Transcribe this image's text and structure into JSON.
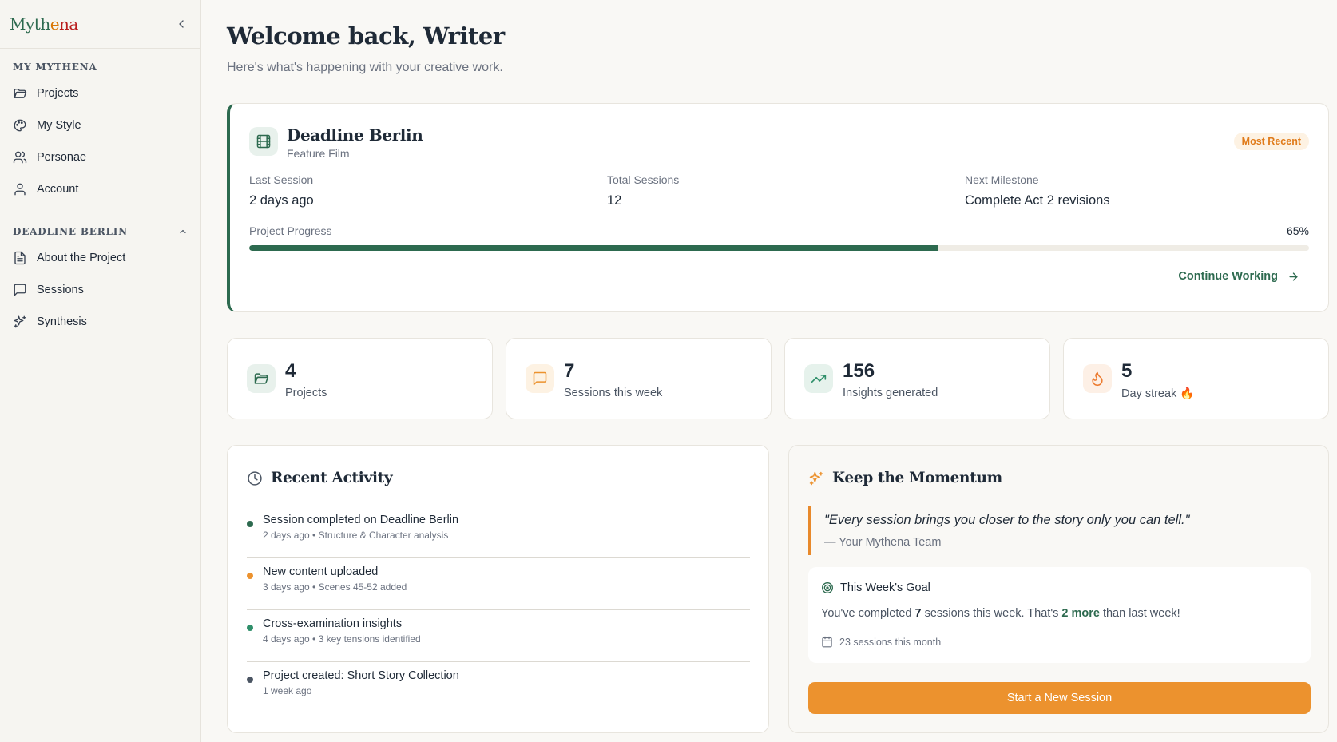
{
  "app": {
    "logo_parts": [
      "Myth",
      "e",
      "na"
    ],
    "colors": {
      "brand_green": "#2d6a4f",
      "accent_orange": "#ec922e",
      "badge_orange": "#e07b1a"
    }
  },
  "sidebar": {
    "sections": [
      {
        "title": "My Mythena",
        "items": [
          {
            "label": "Projects",
            "icon": "folder-icon"
          },
          {
            "label": "My Style",
            "icon": "palette-icon"
          },
          {
            "label": "Personae",
            "icon": "users-icon"
          },
          {
            "label": "Account",
            "icon": "user-icon"
          }
        ]
      },
      {
        "title": "Deadline Berlin",
        "items": [
          {
            "label": "About the Project",
            "icon": "document-icon"
          },
          {
            "label": "Sessions",
            "icon": "chat-bubble-icon"
          },
          {
            "label": "Synthesis",
            "icon": "sparkles-icon"
          }
        ]
      }
    ]
  },
  "header": {
    "welcome": "Welcome back, Writer",
    "subtitle": "Here's what's happening with your creative work."
  },
  "project": {
    "title": "Deadline Berlin",
    "type": "Feature Film",
    "badge": "Most Recent",
    "stats": [
      {
        "label": "Last Session",
        "value": "2 days ago"
      },
      {
        "label": "Total Sessions",
        "value": "12"
      },
      {
        "label": "Next Milestone",
        "value": "Complete Act 2 revisions"
      }
    ],
    "progress_label": "Project Progress",
    "progress_text": "65%",
    "progress_value": 0.65,
    "continue_label": "Continue Working"
  },
  "metrics": [
    {
      "number": "4",
      "label": "Projects",
      "icon": "folder-icon"
    },
    {
      "number": "7",
      "label": "Sessions this week",
      "icon": "chat-bubble-icon"
    },
    {
      "number": "156",
      "label": "Insights generated",
      "icon": "trending-up-icon"
    },
    {
      "number": "5",
      "label": "Day streak 🔥",
      "icon": "flame-icon"
    }
  ],
  "activity": {
    "title": "Recent Activity",
    "items": [
      {
        "title": "Session completed on Deadline Berlin",
        "meta": "2 days ago • Structure & Character analysis",
        "color": "#2d6a4f"
      },
      {
        "title": "New content uploaded",
        "meta": "3 days ago • Scenes 45-52 added",
        "color": "#ec922e"
      },
      {
        "title": "Cross-examination insights",
        "meta": "4 days ago • 3 key tensions identified",
        "color": "#2f8f6a"
      },
      {
        "title": "Project created: Short Story Collection",
        "meta": "1 week ago",
        "color": "#4b5563"
      }
    ]
  },
  "momentum": {
    "title": "Keep the Momentum",
    "quote": "\"Every session brings you closer to the story only you can tell.\"",
    "quote_by": "— Your Mythena Team",
    "goal_title": "This Week's Goal",
    "goal_pre": "You've completed ",
    "goal_count": "7",
    "goal_mid": " sessions this week. That's ",
    "goal_more": "2 more",
    "goal_post": " than last week!",
    "month_text": "23 sessions this month",
    "start_label": "Start a New Session"
  }
}
